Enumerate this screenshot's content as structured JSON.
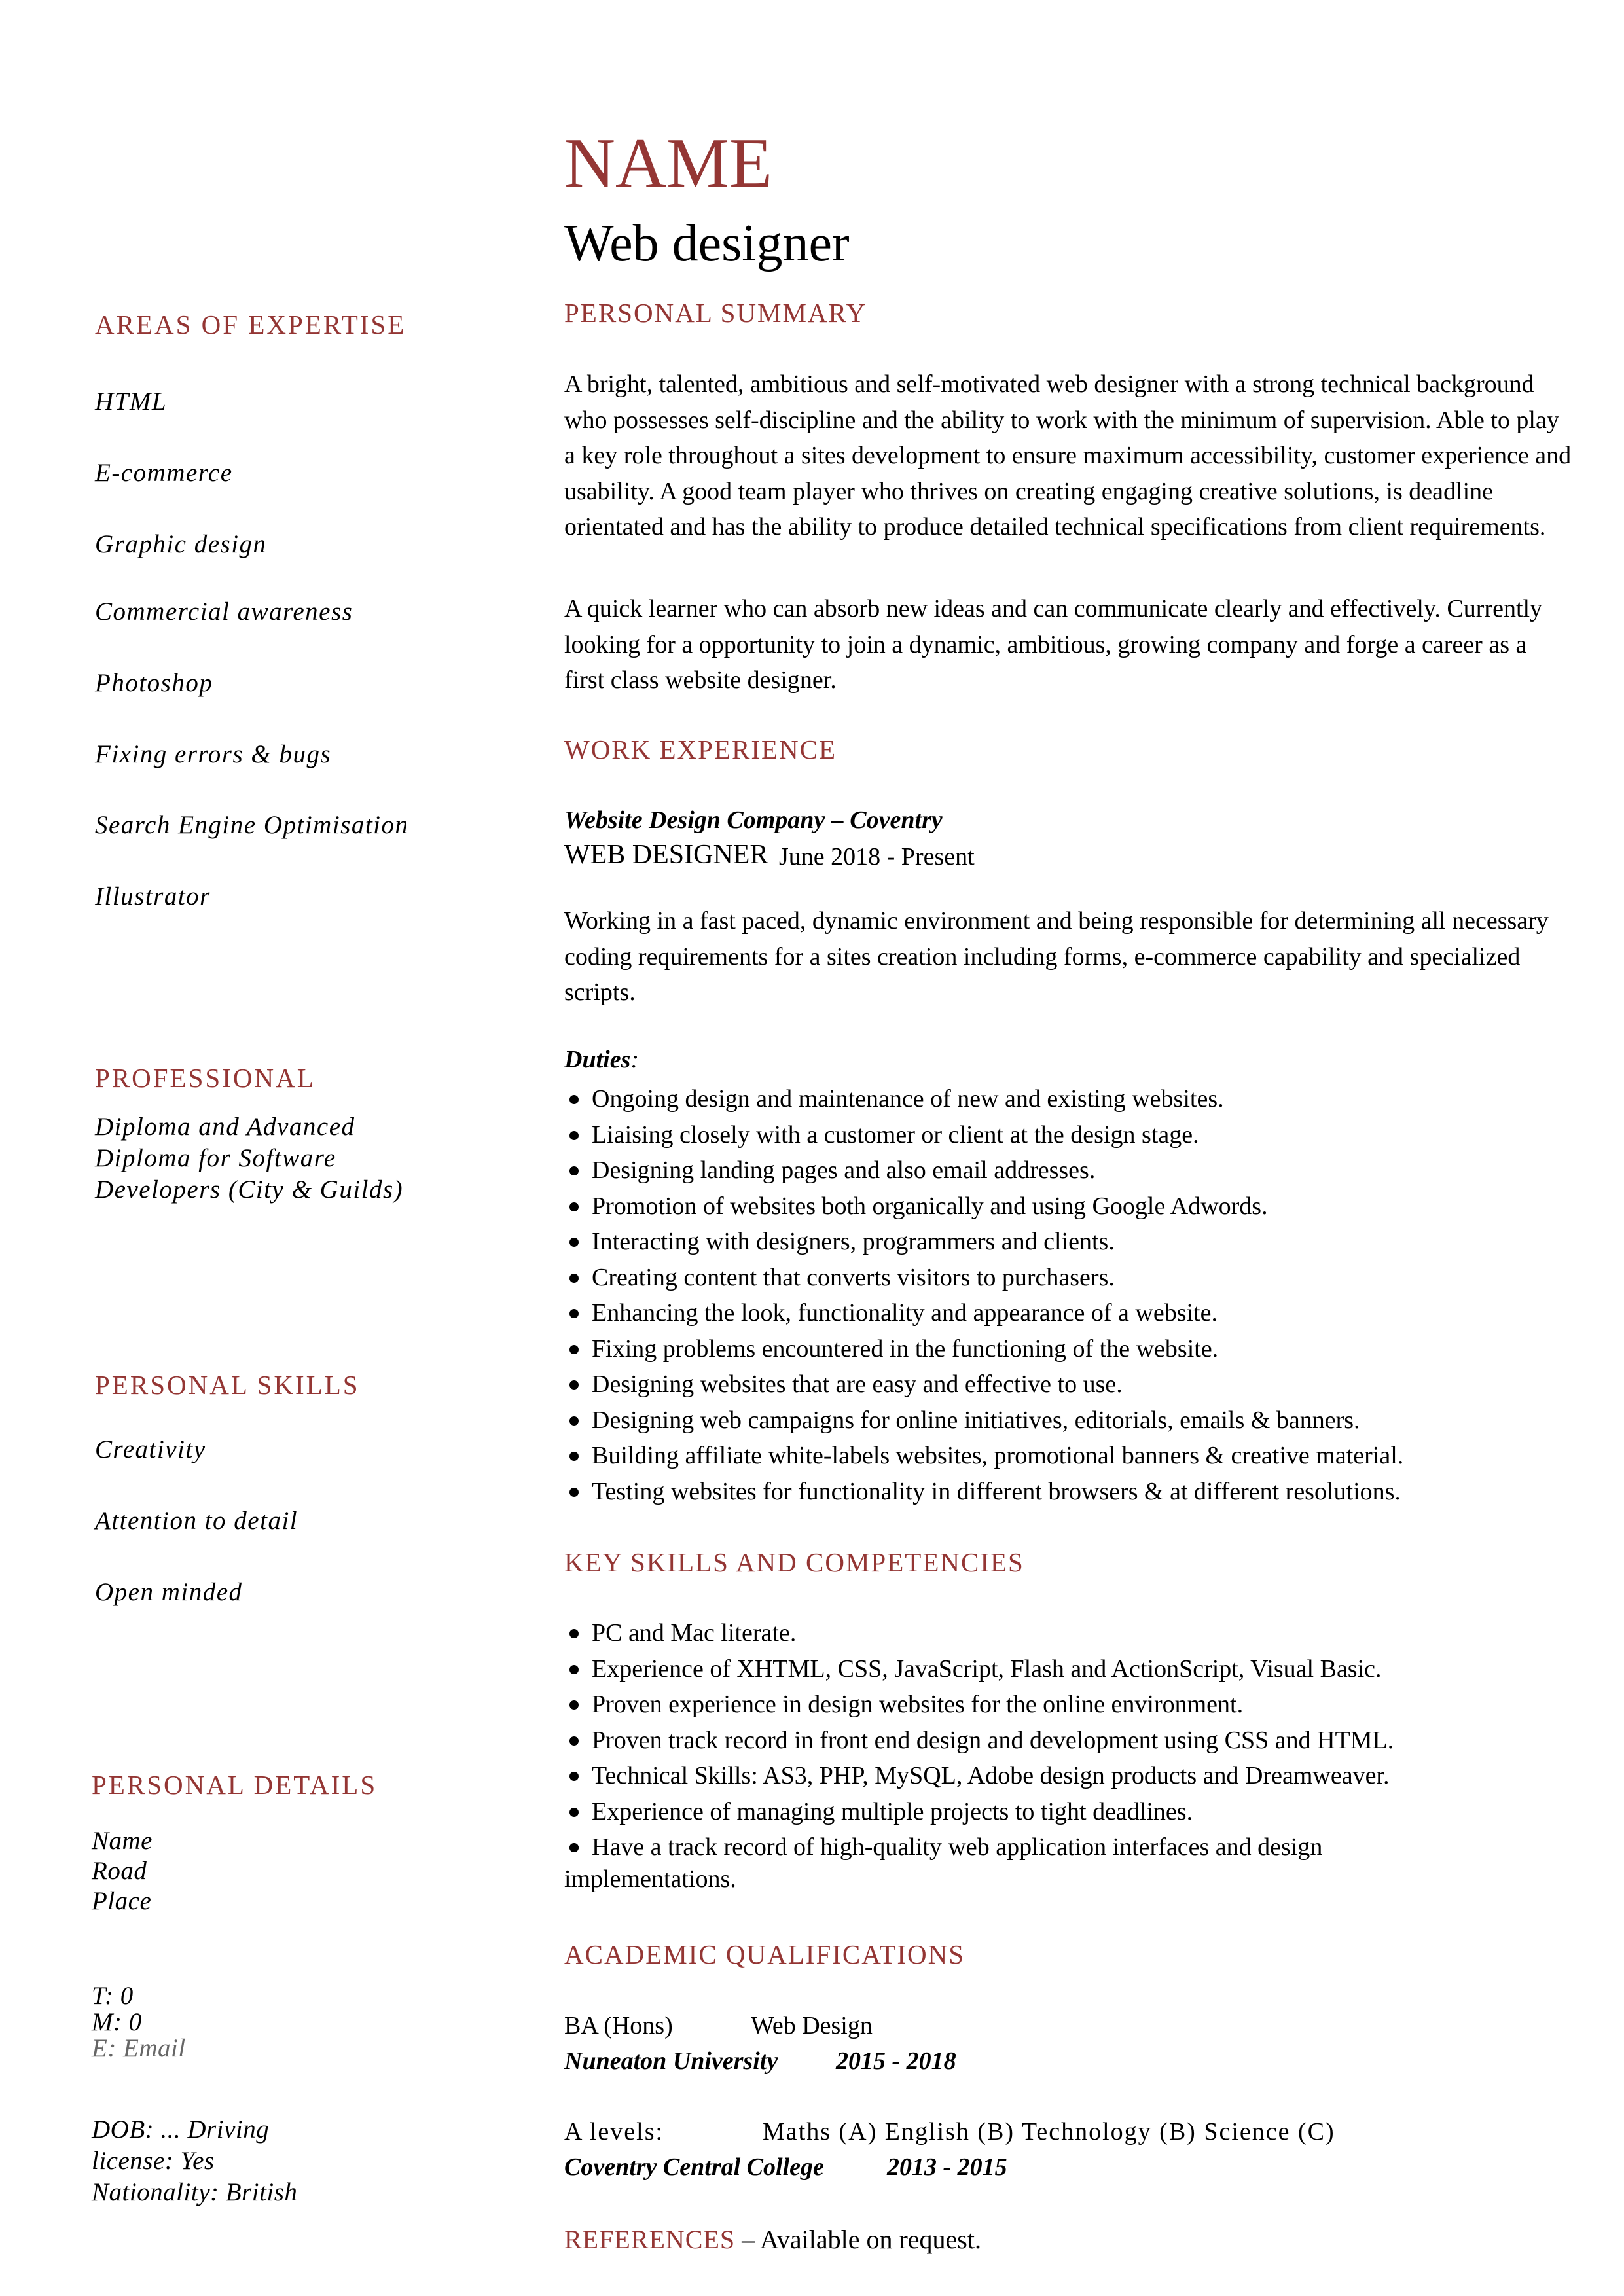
{
  "header": {
    "name": "NAME",
    "job_title": "Web designer"
  },
  "accent_color": "#943634",
  "left": {
    "expertise": {
      "heading": "AREAS OF EXPERTISE",
      "items": [
        "HTML",
        "E-commerce",
        "Graphic design",
        "Commercial awareness",
        "Photoshop",
        "Fixing errors & bugs",
        "Search Engine Optimisation",
        "Illustrator"
      ]
    },
    "professional": {
      "heading": "PROFESSIONAL",
      "lines": [
        "Diploma and Advanced",
        "Diploma for Software",
        "Developers (City & Guilds)"
      ]
    },
    "personal_skills": {
      "heading": "PERSONAL SKILLS",
      "items": [
        "Creativity",
        "Attention to detail",
        "Open minded"
      ]
    },
    "personal_details": {
      "heading": "PERSONAL DETAILS",
      "address": [
        "Name",
        "Road",
        "Place"
      ],
      "phone": "T: 0",
      "mobile": "M: 0",
      "email": "E: Email",
      "other": [
        "DOB: ... Driving",
        "license:  Yes",
        "Nationality: British"
      ]
    }
  },
  "main": {
    "summary": {
      "heading": "PERSONAL SUMMARY",
      "paragraphs": [
        "A bright, talented, ambitious and self-motivated web designer with a strong technical background who possesses self-discipline and the ability to work with the minimum of supervision. Able to play a key role throughout a sites development to ensure maximum accessibility, customer experience and usability. A good team player who thrives on creating engaging creative solutions, is deadline orientated and has the ability to produce detailed technical specifications from client requirements.",
        "A quick learner who can absorb new ideas and can communicate clearly and effectively. Currently looking for a opportunity to join a dynamic, ambitious, growing company and forge a career as a first class website designer."
      ]
    },
    "work": {
      "heading": "WORK EXPERIENCE",
      "company": "Website Design Company – Coventry",
      "role": "WEB DESIGNER",
      "dates": "June 2018 - Present",
      "description": "Working in a fast paced, dynamic environment and being responsible for determining all necessary coding requirements for a sites creation including forms, e-commerce capability and specialized scripts.",
      "duties_label": "Duties",
      "duties_colon": ":",
      "duties": [
        "Ongoing design and maintenance of new and existing websites.",
        "Liaising closely with a customer or client at the design stage.",
        "Designing landing pages and also email addresses.",
        "Promotion of websites both organically and using Google Adwords.",
        "Interacting with designers, programmers and clients.",
        "Creating content that converts visitors to purchasers.",
        "Enhancing the look, functionality and appearance of a website.",
        "Fixing problems encountered in the functioning of the website.",
        "Designing websites that are easy and effective to use.",
        "Designing web campaigns for online initiatives, editorials, emails & banners.",
        "Building affiliate white-labels websites, promotional banners & creative material.",
        "Testing websites for functionality in different browsers & at different resolutions."
      ]
    },
    "skills": {
      "heading": "KEY SKILLS AND COMPETENCIES",
      "items": [
        "PC and Mac literate.",
        "Experience of XHTML, CSS, JavaScript, Flash and ActionScript, Visual Basic.",
        "Proven experience in design websites for the online environment.",
        "Proven track record in front end design and development using CSS and HTML.",
        "Technical Skills: AS3, PHP, MySQL, Adobe design products and Dreamweaver.",
        "Experience of managing multiple projects to tight deadlines."
      ],
      "last_item_line1": "Have a track record of high-quality web application interfaces and design",
      "last_item_line2": "implementations."
    },
    "academic": {
      "heading": "ACADEMIC QUALIFICATIONS",
      "degree": "BA (Hons)",
      "subject": "Web Design",
      "university": "Nuneaton University",
      "uni_dates": "2015 - 2018",
      "alevels_label": "A levels:",
      "alevels_subjects": "Maths (A) English (B) Technology (B) Science (C)",
      "college": "Coventry Central College",
      "college_dates": "2013 - 2015"
    },
    "references": {
      "heading": "REFERENCES",
      "text": " – Available on request."
    }
  }
}
